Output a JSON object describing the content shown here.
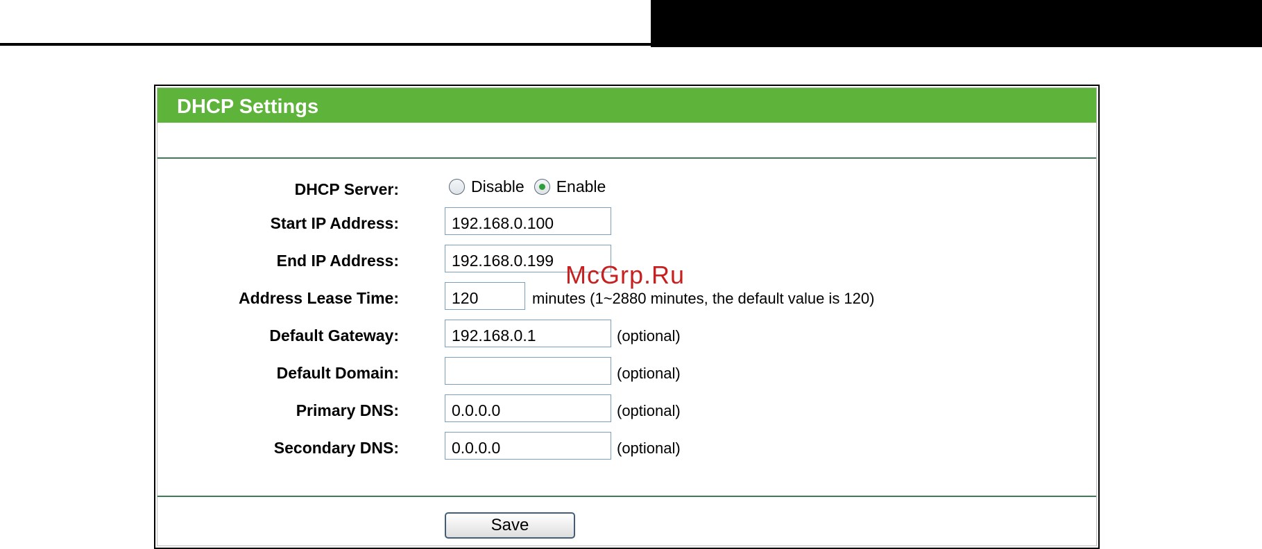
{
  "page": {
    "title": "DHCP Settings",
    "watermark": "McGrp.Ru"
  },
  "dhcp_server": {
    "label": "DHCP Server:",
    "options": [
      {
        "label": "Disable",
        "selected": false
      },
      {
        "label": "Enable",
        "selected": true
      }
    ]
  },
  "start_ip": {
    "label": "Start IP Address:",
    "value": "192.168.0.100"
  },
  "end_ip": {
    "label": "End IP Address:",
    "value": "192.168.0.199"
  },
  "lease_time": {
    "label": "Address Lease Time:",
    "value": "120",
    "hint": "minutes (1~2880 minutes, the default value is 120)"
  },
  "gateway": {
    "label": "Default Gateway:",
    "value": "192.168.0.1",
    "hint": "(optional)"
  },
  "domain": {
    "label": "Default Domain:",
    "value": "",
    "hint": "(optional)"
  },
  "primary_dns": {
    "label": "Primary DNS:",
    "value": "0.0.0.0",
    "hint": "(optional)"
  },
  "secondary_dns": {
    "label": "Secondary DNS:",
    "value": "0.0.0.0",
    "hint": "(optional)"
  },
  "actions": {
    "save_label": "Save"
  },
  "colors": {
    "header": "#5eb43a",
    "divider": "#3d7a56",
    "selected_dot": "#2e9e3a",
    "field_border": "#7b9ebd"
  }
}
